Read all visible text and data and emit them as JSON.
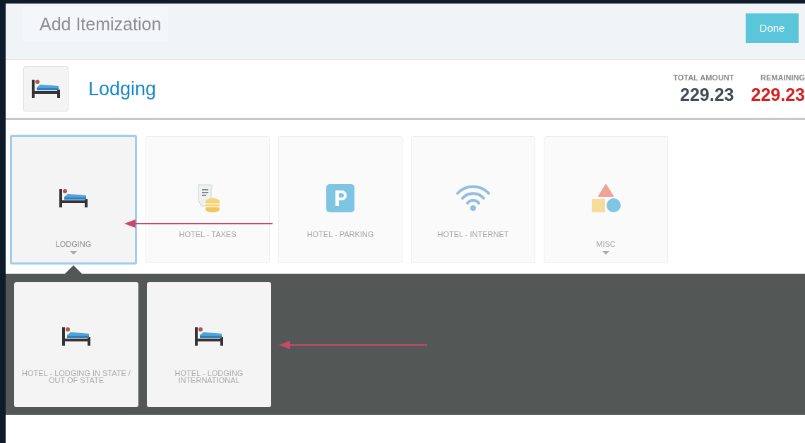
{
  "dialog": {
    "title": "Add Itemization",
    "done_button": "Done"
  },
  "expense": {
    "kind": "lodging",
    "name": "Lodging",
    "total_label": "TOTAL AMOUNT",
    "total": "229.23",
    "remaining_label": "REMAINING",
    "remaining": "229.23"
  },
  "types": [
    {
      "kind": "lodging",
      "label": "LODGING",
      "selected": true,
      "expandable": true
    },
    {
      "kind": "taxes",
      "label": "HOTEL - TAXES",
      "selected": false,
      "expandable": false
    },
    {
      "kind": "parking",
      "label": "HOTEL - PARKING",
      "selected": false,
      "expandable": false
    },
    {
      "kind": "internet",
      "label": "HOTEL - INTERNET",
      "selected": false,
      "expandable": false
    },
    {
      "kind": "misc",
      "label": "MISC",
      "selected": false,
      "expandable": true
    }
  ],
  "subtypes": [
    {
      "kind": "lodging",
      "label": "HOTEL - LODGING IN STATE / OUT OF STATE"
    },
    {
      "kind": "lodging",
      "label": "HOTEL - LODGING INTERNATIONAL"
    }
  ]
}
